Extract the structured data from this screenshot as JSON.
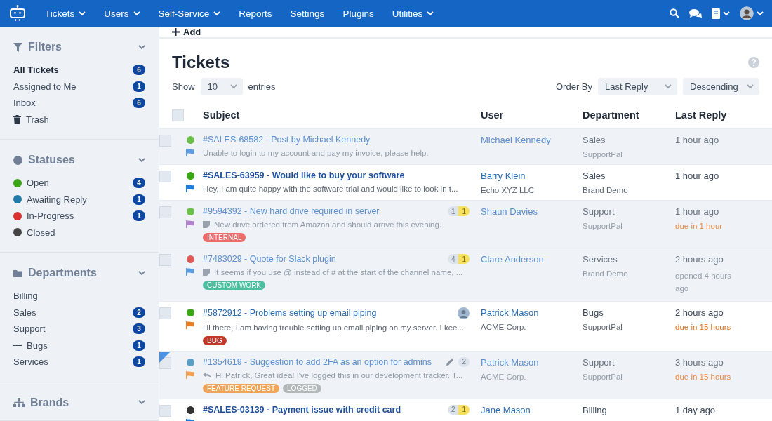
{
  "nav": {
    "items": [
      {
        "label": "Tickets",
        "dropdown": true
      },
      {
        "label": "Users",
        "dropdown": true
      },
      {
        "label": "Self-Service",
        "dropdown": true
      },
      {
        "label": "Reports",
        "dropdown": false
      },
      {
        "label": "Settings",
        "dropdown": false
      },
      {
        "label": "Plugins",
        "dropdown": false
      },
      {
        "label": "Utilities",
        "dropdown": true
      }
    ]
  },
  "sidebar": {
    "sections": [
      {
        "title": "Filters",
        "kind": "filter",
        "items": [
          {
            "label": "All Tickets",
            "count": "6",
            "selected": true,
            "kind": "plain"
          },
          {
            "label": "Assigned to Me",
            "count": "1",
            "selected": false,
            "kind": "plain"
          },
          {
            "label": "Inbox",
            "count": "6",
            "selected": false,
            "kind": "plain"
          },
          {
            "label": "Trash",
            "selected": false,
            "kind": "trash"
          }
        ]
      },
      {
        "title": "Statuses",
        "kind": "status",
        "items": [
          {
            "label": "Open",
            "count": "4",
            "selected": false,
            "kind": "dot",
            "color": "#3aa515"
          },
          {
            "label": "Awaiting Reply",
            "count": "1",
            "selected": false,
            "kind": "dot",
            "color": "#1f7ba8"
          },
          {
            "label": "In-Progress",
            "count": "1",
            "selected": false,
            "kind": "dot",
            "color": "#d93030"
          },
          {
            "label": "Closed",
            "selected": false,
            "kind": "dot",
            "color": "#444444"
          }
        ]
      },
      {
        "title": "Departments",
        "kind": "folder",
        "items": [
          {
            "label": "Billing",
            "selected": false,
            "kind": "plain"
          },
          {
            "label": "Sales",
            "count": "2",
            "selected": false,
            "kind": "plain"
          },
          {
            "label": "Support",
            "count": "3",
            "selected": false,
            "kind": "plain"
          },
          {
            "label": "Bugs",
            "count": "1",
            "selected": false,
            "kind": "sub"
          },
          {
            "label": "Services",
            "count": "1",
            "selected": false,
            "kind": "plain"
          }
        ]
      },
      {
        "title": "Brands",
        "kind": "brand"
      }
    ]
  },
  "toolbar": {
    "add": "Add"
  },
  "page": {
    "title": "Tickets",
    "show_label": "Show",
    "entries_value": "10",
    "entries_label": "entries",
    "order_label": "Order By",
    "order_value": "Last Reply",
    "direction_value": "Descending"
  },
  "table": {
    "select_all": {
      "checked": false
    },
    "columns": [
      "Subject",
      "User",
      "Department",
      "Last Reply"
    ],
    "rows": [
      {
        "checked": false,
        "read": true,
        "bold": false,
        "marked": false,
        "status": {
          "color": "#6cc04a"
        },
        "flag": {
          "color": "#5b9be0"
        },
        "subject": "#SALES-68582 - Post by Michael Kennedy",
        "preview": {
          "kind": "plain",
          "text": "Unable to login to my account and pay my invoice, please help."
        },
        "user": "Michael Kennedy",
        "department": "Sales",
        "brand": "SupportPal",
        "last_reply": "1 hour ago"
      },
      {
        "checked": false,
        "read": false,
        "bold": true,
        "marked": false,
        "status": {
          "color": "#3aa515"
        },
        "flag": {
          "color": "#1f7bd8"
        },
        "subject": "#SALES-63959 - Would like to buy your software",
        "preview": {
          "kind": "plain",
          "text": "Hey, I am quite happy with the software trial and would like to look in t..."
        },
        "user": "Barry Klein",
        "organisation": "Echo XYZ LLC",
        "department": "Sales",
        "brand": "Brand Demo",
        "last_reply": "1 hour ago"
      },
      {
        "checked": false,
        "read": true,
        "bold": false,
        "marked": false,
        "status": {
          "color": "#6cc04a"
        },
        "flag": {
          "color": "#b183cc"
        },
        "subject": "#9594392 - New hard drive required in server",
        "preview": {
          "kind": "note",
          "text": "New drive ordered from Amazon and should arrive this evening."
        },
        "counts": [
          {
            "text": "1",
            "kind": "grey"
          },
          {
            "text": "1",
            "kind": "yellow"
          }
        ],
        "tags": [
          {
            "text": "INTERNAL",
            "color": "#ec6b6b"
          }
        ],
        "user": "Shaun Davies",
        "department": "Support",
        "brand": "SupportPal",
        "last_reply": "1 hour ago",
        "note": {
          "text": "due in 1 hour",
          "kind": "due"
        }
      },
      {
        "checked": false,
        "read": true,
        "bold": false,
        "marked": false,
        "status": {
          "color": "#e05a5a"
        },
        "flag": {
          "color": "#5b9be0"
        },
        "subject": "#7483029 - Quote for Slack plugin",
        "preview": {
          "kind": "note",
          "text": "It seems if you use @ instead of # at the start of the channel name, ..."
        },
        "counts": [
          {
            "text": "4",
            "kind": "grey"
          },
          {
            "text": "1",
            "kind": "yellow"
          }
        ],
        "tags": [
          {
            "text": "CUSTOM WORK",
            "color": "#4cbfa0"
          }
        ],
        "user": "Clare Anderson",
        "department": "Services",
        "brand": "Brand Demo",
        "last_reply": "2 hours ago",
        "note": {
          "text": "opened 4 hours ago",
          "kind": "opened"
        }
      },
      {
        "checked": false,
        "read": false,
        "bold": false,
        "marked": false,
        "status": {
          "color": "#3aa515"
        },
        "flag": {
          "color": "#e67e22"
        },
        "indicator": {
          "kind": "avatar"
        },
        "subject": "#5872912 - Problems setting up email piping",
        "preview": {
          "kind": "plain",
          "text": "Hi there, I am having trouble setting up email piping on my server. I kee..."
        },
        "tags": [
          {
            "text": "BUG",
            "color": "#c0392b"
          }
        ],
        "user": "Patrick Mason",
        "organisation": "ACME Corp.",
        "department": "Bugs",
        "brand": "SupportPal",
        "last_reply": "2 hours ago",
        "note": {
          "text": "due in 15 hours",
          "kind": "due"
        }
      },
      {
        "checked": false,
        "read": true,
        "bold": false,
        "marked": true,
        "status": {
          "color": "#5b9dc4"
        },
        "flag": {
          "color": "#f0a050"
        },
        "indicator": {
          "kind": "pencil"
        },
        "subject": "#1354619 - Suggestion to add 2FA as an option for admins",
        "preview": {
          "kind": "reply",
          "text": "Hi Patrick, Great idea! I've logged this in our development tracker. T..."
        },
        "counts": [
          {
            "text": "2",
            "kind": "grey"
          }
        ],
        "tags": [
          {
            "text": "FEATURE REQUEST",
            "color": "#f0a458"
          },
          {
            "text": "LOGGED",
            "color": "#b3b9b9"
          }
        ],
        "user": "Patrick Mason",
        "organisation": "ACME Corp.",
        "department": "Support",
        "brand": "SupportPal",
        "last_reply": "3 hours ago",
        "note": {
          "text": "due in 15 hours",
          "kind": "due"
        }
      },
      {
        "checked": false,
        "read": false,
        "bold": true,
        "marked": false,
        "status": {
          "color": "#333333"
        },
        "flag": {
          "color": "#1f7bd8"
        },
        "subject": "#SALES-03139 - Payment issue with credit card",
        "counts": [
          {
            "text": "2",
            "kind": "grey"
          },
          {
            "text": "1",
            "kind": "yellow"
          }
        ],
        "user": "Jane Mason",
        "department": "Billing",
        "last_reply": "1 day ago"
      }
    ]
  }
}
